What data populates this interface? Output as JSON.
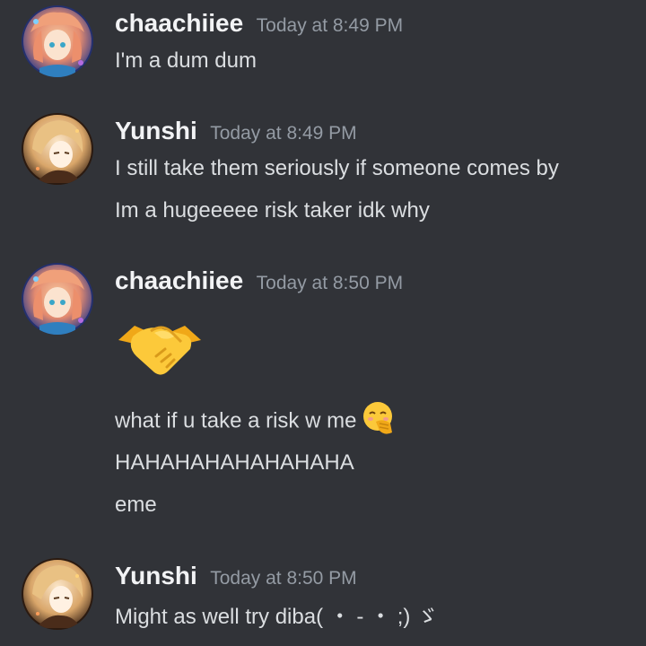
{
  "messages": [
    {
      "username": "chaachiiee",
      "timestamp": "Today at 8:49 PM",
      "lines": [
        "I'm a dum dum"
      ]
    },
    {
      "username": "Yunshi",
      "timestamp": "Today at 8:49 PM",
      "lines": [
        "I still take them seriously if someone comes by",
        "Im a hugeeeee risk taker idk why"
      ]
    },
    {
      "username": "chaachiiee",
      "timestamp": "Today at 8:50 PM",
      "emoji": "handshake-emoji",
      "lines": [
        "what if u take a risk w me",
        "HAHAHAHAHAHAHAHA",
        "eme"
      ],
      "inline_emoji": "face-with-hand-over-mouth-emoji"
    },
    {
      "username": "Yunshi",
      "timestamp": "Today at 8:50 PM",
      "lines": [
        "Might as well try diba( ・ - ・ ;) ゞ"
      ]
    }
  ],
  "colors": {
    "background": "#313338",
    "username": "#f2f3f5",
    "timestamp": "#949ba4",
    "text": "#dbdee1"
  }
}
